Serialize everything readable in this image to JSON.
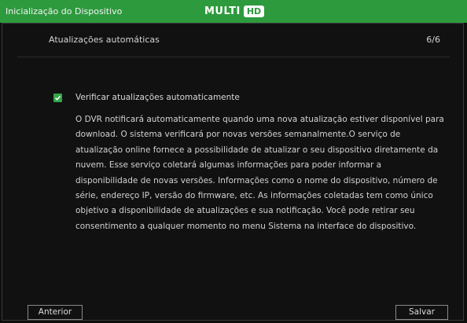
{
  "window": {
    "title": "Inicialização do Dispositivo",
    "logo_main": "MULTI",
    "logo_badge": "HD"
  },
  "page": {
    "heading": "Atualizações automáticas",
    "step": "6/6"
  },
  "option": {
    "checked": true,
    "label": "Verificar atualizações automaticamente"
  },
  "description": "O DVR notificará automaticamente quando uma nova atualização estiver disponível para download. O sistema verificará por novas versões semanalmente.O serviço de atualização online fornece a possibilidade de atualizar o seu dispositivo diretamente da nuvem. Esse serviço coletará algumas informações para poder informar a disponibilidade de novas versões. Informações como o nome do dispositivo, número de série, endereço IP, versão do firmware, etc. As informações coletadas tem como único objetivo a disponibilidade de atualizações e sua notificação. Você pode retirar seu consentimento a qualquer momento no menu Sistema na interface do dispositivo.",
  "buttons": {
    "previous": "Anterior",
    "save": "Salvar"
  },
  "colors": {
    "titlebar": "#2d9a3e",
    "accent_checkbox": "#35a54a",
    "background": "#0e0f0c"
  },
  "icons": {
    "checkbox": "check-icon"
  }
}
